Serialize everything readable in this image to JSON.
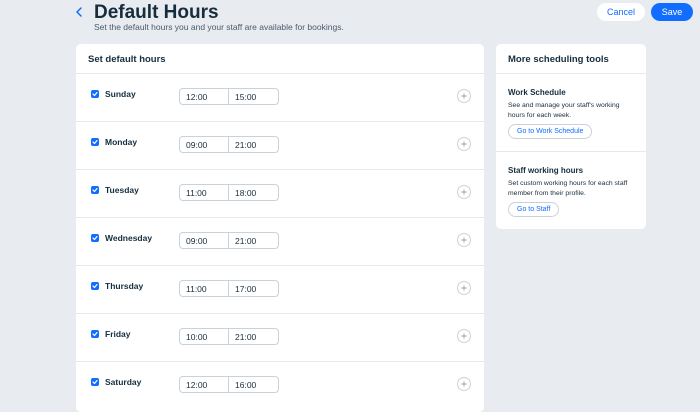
{
  "header": {
    "title": "Default Hours",
    "subtitle": "Set the default hours you and your staff are available for bookings.",
    "cancel_label": "Cancel",
    "save_label": "Save"
  },
  "main": {
    "title": "Set default hours",
    "days": [
      {
        "name": "Sunday",
        "checked": true,
        "start": "12:00",
        "end": "15:00"
      },
      {
        "name": "Monday",
        "checked": true,
        "start": "09:00",
        "end": "21:00"
      },
      {
        "name": "Tuesday",
        "checked": true,
        "start": "11:00",
        "end": "18:00"
      },
      {
        "name": "Wednesday",
        "checked": true,
        "start": "09:00",
        "end": "21:00"
      },
      {
        "name": "Thursday",
        "checked": true,
        "start": "11:00",
        "end": "17:00"
      },
      {
        "name": "Friday",
        "checked": true,
        "start": "10:00",
        "end": "21:00"
      },
      {
        "name": "Saturday",
        "checked": true,
        "start": "12:00",
        "end": "16:00"
      }
    ]
  },
  "side": {
    "title": "More scheduling tools",
    "sections": [
      {
        "heading": "Work Schedule",
        "description": "See and manage your staff's working hours for each week.",
        "link_label": "Go to Work Schedule"
      },
      {
        "heading": "Staff working hours",
        "description": "Set custom working hours for each staff member from their profile.",
        "link_label": "Go to Staff"
      }
    ]
  },
  "icons": {
    "back": "chevron-left-icon",
    "checkbox": "checkmark-icon",
    "add": "plus-icon"
  },
  "colors": {
    "accent": "#116dff",
    "background": "#e8ebf0",
    "text": "#162d3d"
  }
}
